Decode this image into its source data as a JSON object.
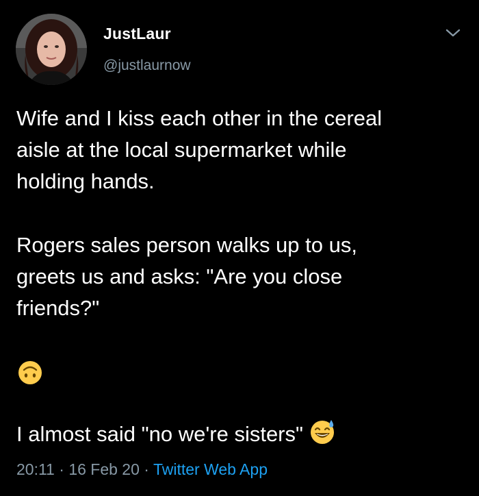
{
  "user": {
    "display_name": "JustLaur",
    "handle": "@justlaurnow"
  },
  "tweet": {
    "paragraph1": "Wife and I kiss each other in the cereal\naisle at the local supermarket while\nholding hands.",
    "paragraph2": "Rogers sales person walks up to us,\ngreets us and asks: \"Are you close\nfriends?\"",
    "emoji_line_icon": "upside-down-face-emoji-icon",
    "paragraph4": "I almost said \"no we're sisters\"",
    "trailing_emoji_icon": "grinning-face-with-sweat-emoji-icon"
  },
  "meta": {
    "time": "20:11",
    "separator1": " · ",
    "date": "16 Feb 20",
    "separator2": " · ",
    "source": "Twitter Web App"
  },
  "colors": {
    "background": "#000000",
    "text": "#ffffff",
    "secondary": "#8899a6",
    "link": "#1da1f2",
    "emoji_yellow": "#ffcc4d"
  }
}
